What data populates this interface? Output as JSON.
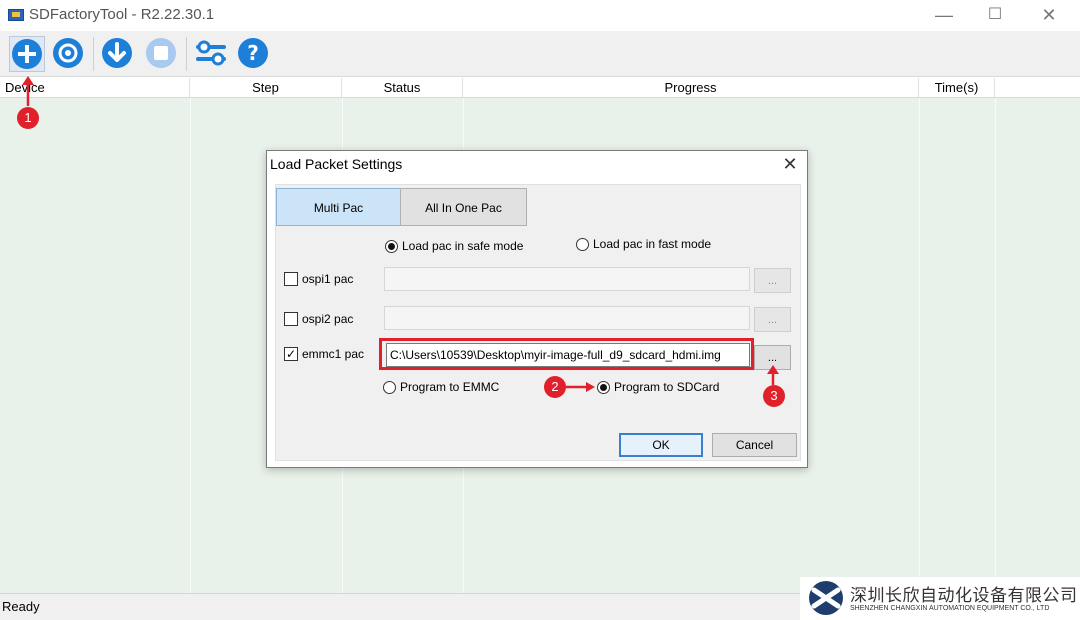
{
  "window": {
    "title": "SDFactoryTool - R2.22.30.1",
    "minimize_glyph": "—",
    "maximize_glyph": "☐",
    "close_glyph": "✕"
  },
  "toolbar": {
    "buttons": [
      {
        "icon": "add-icon",
        "color": "#1e7fd8"
      },
      {
        "icon": "settings-icon",
        "color": "#1e7fd8"
      },
      {
        "icon": "download-icon",
        "color": "#1e7fd8"
      },
      {
        "icon": "stop-icon",
        "color": "#a9c9ee"
      },
      {
        "icon": "configure-icon",
        "color": "#1e7fd8"
      },
      {
        "icon": "help-icon",
        "color": "#1e7fd8"
      }
    ]
  },
  "table": {
    "columns": [
      "Device",
      "Step",
      "Status",
      "Progress",
      "Time(s)"
    ]
  },
  "dialog": {
    "title": "Load Packet Settings",
    "close_glyph": "✕",
    "tabs": [
      {
        "label": "Multi Pac",
        "selected": true
      },
      {
        "label": "All In One Pac",
        "selected": false
      }
    ],
    "load_mode": {
      "options": [
        "Load pac in safe mode",
        "Load pac in fast mode"
      ],
      "selected": "Load pac in safe mode"
    },
    "rows": [
      {
        "label": "ospi1 pac",
        "checked": false,
        "path": "",
        "browse": "..."
      },
      {
        "label": "ospi2 pac",
        "checked": false,
        "path": "",
        "browse": "..."
      },
      {
        "label": "emmc1 pac",
        "checked": true,
        "path": "C:\\Users\\10539\\Desktop\\myir-image-full_d9_sdcard_hdmi.img",
        "browse": "..."
      }
    ],
    "program_target": {
      "options": [
        "Program to EMMC",
        "Program to SDCard"
      ],
      "selected": "Program to SDCard"
    },
    "ok_label": "OK",
    "cancel_label": "Cancel"
  },
  "annotations": {
    "markers": [
      "1",
      "2",
      "3"
    ],
    "color": "#e0202a"
  },
  "status": {
    "text": "Ready"
  },
  "company": {
    "name_cn": "深圳长欣自动化设备有限公司",
    "name_en": "SHENZHEN CHANGXIN AUTOMATION EQUIPMENT CO., LTD"
  }
}
